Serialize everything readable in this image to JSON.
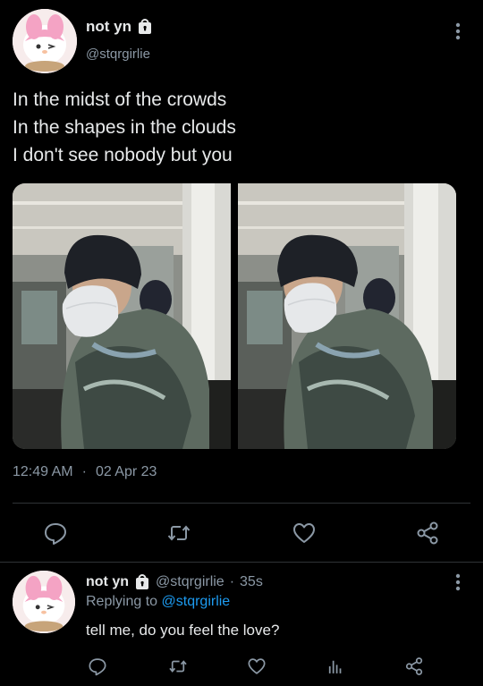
{
  "tweet": {
    "author_name": "not yn",
    "author_handle": "@stqrgirlie",
    "text_lines": [
      "In the midst of the crowds",
      "In the shapes in the clouds",
      "I don't see nobody but you"
    ],
    "time": "12:49 AM",
    "separator": "·",
    "date": "02 Apr 23",
    "actions": [
      "reply-icon",
      "retweet-icon",
      "like-icon",
      "share-icon"
    ]
  },
  "reply": {
    "author_name": "not yn",
    "author_handle": "@stqrgirlie",
    "time_separator": "·",
    "time": "35s",
    "replying_prefix": "Replying to",
    "replying_to": "@stqrgirlie",
    "text": "tell me, do you feel the love?",
    "actions": [
      "reply-icon",
      "retweet-icon",
      "like-icon",
      "analytics-icon",
      "share-icon"
    ]
  },
  "colors": {
    "background": "#000000",
    "text": "#e7e9ea",
    "muted": "#8b98a5",
    "accent": "#1d9bf0",
    "divider": "#2f3336"
  }
}
